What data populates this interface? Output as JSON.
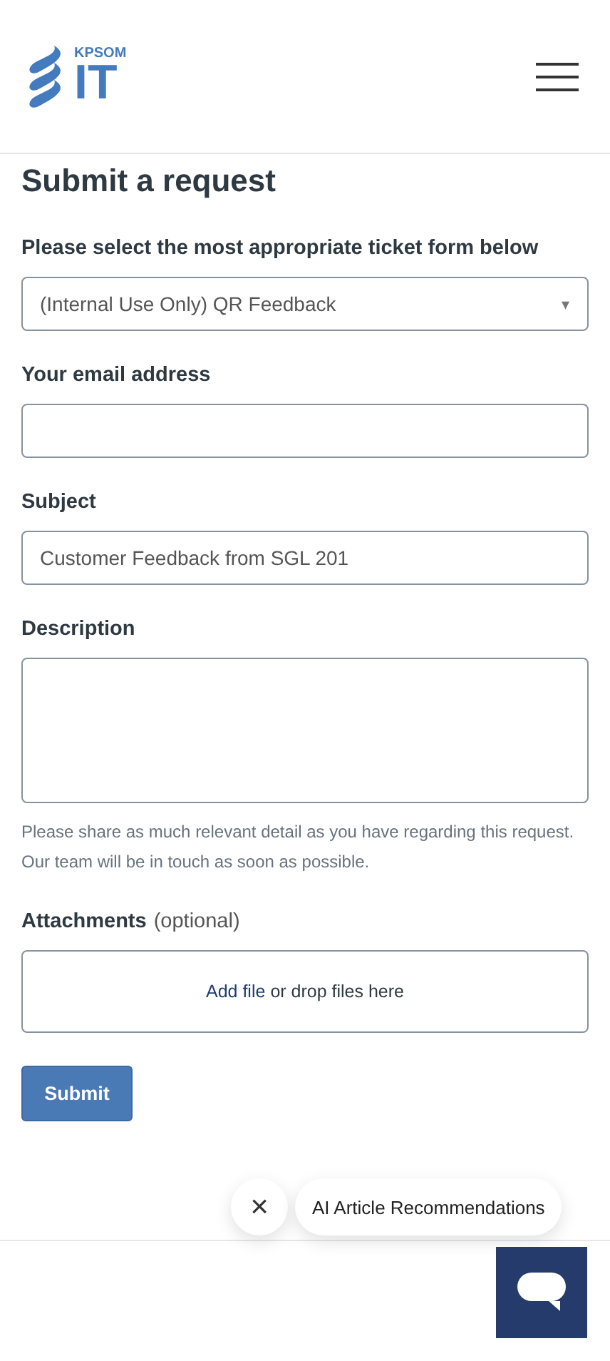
{
  "header": {
    "logo": {
      "small": "KPSOM",
      "large": "IT"
    }
  },
  "page_title": "Submit a request",
  "fields": [
    {
      "kind": "select",
      "label": "Please select the most appropriate ticket form below",
      "value": "(Internal Use Only) QR Feedback",
      "caret": "▾"
    },
    {
      "kind": "text",
      "label": "Your email address"
    },
    {
      "kind": "text",
      "label": "Subject",
      "value": "Customer Feedback from SGL 201"
    },
    {
      "kind": "textarea",
      "label": "Description",
      "hint": "Please share as much relevant detail as you have regarding this request. Our team will be in touch as soon as possible."
    },
    {
      "kind": "file",
      "label": "Attachments",
      "note": "(optional)",
      "link": "Add file",
      "text": "or drop files here"
    }
  ],
  "submit": "Submit",
  "chat": {
    "close": "×",
    "bubble": "AI Article Recommendations"
  }
}
